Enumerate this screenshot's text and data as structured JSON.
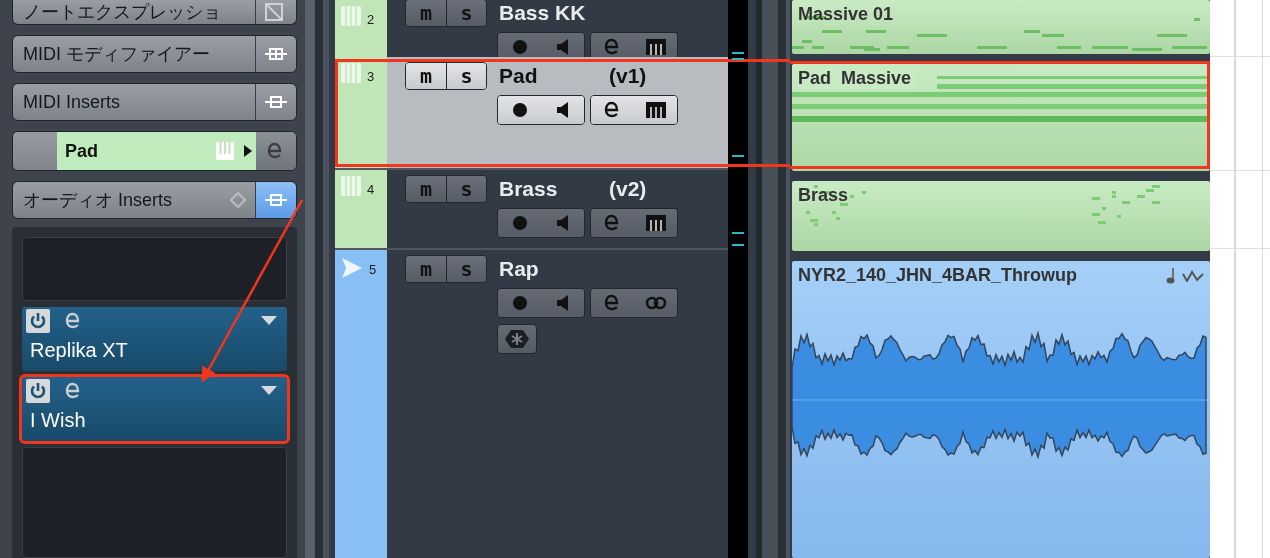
{
  "inspector": {
    "sections": [
      {
        "kind": "expression",
        "label": "ノートエクスプレッショ"
      },
      {
        "kind": "modifiers",
        "label": "MIDI モディファイアー"
      },
      {
        "kind": "inserts",
        "label": "MIDI Inserts"
      },
      {
        "kind": "track",
        "label": "Pad",
        "color": "#c0ebbd"
      },
      {
        "kind": "inserts",
        "label": "オーディオ Inserts",
        "active": true
      }
    ],
    "insert_slots": [
      {
        "kind": "empty"
      },
      {
        "kind": "plugin",
        "name": "Replika XT",
        "highlighted": false
      },
      {
        "kind": "plugin",
        "name": "I Wish",
        "highlighted": true
      },
      {
        "kind": "empty"
      }
    ]
  },
  "tracks": [
    {
      "kind": "instrument",
      "number": "2",
      "name": "Bass KK",
      "color": "#c0e6b8",
      "selected": false,
      "highlighted": false,
      "mute": "m",
      "solo": "s"
    },
    {
      "kind": "instrument",
      "number": "3",
      "name": "Pad",
      "version": "(v1)",
      "color": "#c0e6b8",
      "selected": true,
      "highlighted": true,
      "mute": "m",
      "solo": "s"
    },
    {
      "kind": "instrument",
      "number": "4",
      "name": "Brass",
      "version": "(v2)",
      "color": "#c0e6b8",
      "selected": false,
      "highlighted": false,
      "mute": "m",
      "solo": "s"
    },
    {
      "kind": "audio",
      "number": "5",
      "name": "Rap",
      "color": "#88bff5",
      "selected": false,
      "highlighted": false,
      "mute": "m",
      "solo": "s"
    }
  ],
  "clips": [
    {
      "kind": "midi",
      "name": "Massive 01",
      "highlighted": false
    },
    {
      "kind": "midi",
      "name": "Pad  Massive",
      "highlighted": true
    },
    {
      "kind": "midi",
      "name": "Brass",
      "highlighted": false
    },
    {
      "kind": "audio",
      "name": "NYR2_140_JHN_4BAR_Throwup",
      "highlighted": false
    }
  ],
  "annotations": [
    {
      "kind": "arrow"
    }
  ]
}
